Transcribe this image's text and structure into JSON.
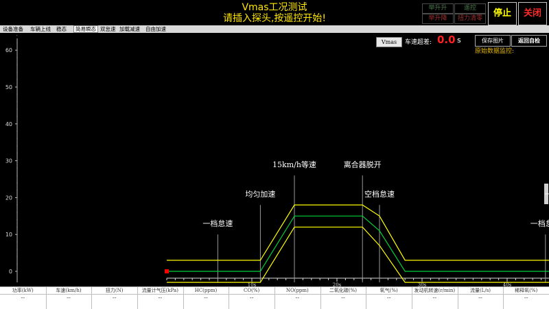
{
  "header": {
    "title": "Vmas工况测试",
    "subtitle": "请插入探头,按遥控开始!",
    "buttons": {
      "lift_up": "举升升",
      "remote": "遥控",
      "lift_down": "举升降",
      "force_clear": "扭力清零",
      "stop": "停止",
      "close": "关闭"
    }
  },
  "tabs": [
    "设备准备",
    "车辆上线",
    "稳态",
    "简易瞬态",
    "双怠速",
    "加载减速",
    "自由加速"
  ],
  "active_tab_index": 3,
  "overlay": {
    "vmas_label": "Vmas",
    "overspeed_label": "车速超差:",
    "overspeed_value": "0.0",
    "overspeed_unit": "s",
    "save_image": "保存图片",
    "return_check": "返回自检",
    "raw_monitor": "原始数据监控:"
  },
  "colors": {
    "title": "#ffe600",
    "limit_line": "#ffff00",
    "target_line": "#00d23c",
    "overspeed": "#ff2020",
    "stop": "#ffff00",
    "close": "#ff2a2a"
  },
  "chart_data": {
    "type": "line",
    "x": [
      0,
      10,
      11,
      15,
      23,
      25,
      28,
      38,
      45
    ],
    "ylim": [
      -3,
      65
    ],
    "yticks": [
      0,
      10,
      20,
      30,
      40,
      50,
      60
    ],
    "xticks": [
      {
        "x": 10,
        "label": "10s"
      },
      {
        "x": 20,
        "label": "20s"
      },
      {
        "x": 30,
        "label": "30s"
      },
      {
        "x": 40,
        "label": "40s"
      }
    ],
    "series": [
      {
        "role": "upper",
        "values": [
          3,
          3,
          3,
          18,
          18,
          15,
          3,
          3,
          3
        ]
      },
      {
        "role": "target",
        "values": [
          0,
          0,
          0,
          15,
          15,
          11,
          0,
          0,
          0
        ]
      },
      {
        "role": "lower",
        "values": [
          -3,
          -3,
          -3,
          12,
          12,
          7,
          -3,
          -3,
          -3
        ]
      }
    ],
    "phase_markers": [
      {
        "x": 6,
        "y_top": 10,
        "label": "一档怠速"
      },
      {
        "x": 11,
        "y_top": 18,
        "label": "均匀加速"
      },
      {
        "x": 15,
        "y_top": 26,
        "label": "15km/h等速"
      },
      {
        "x": 23,
        "y_top": 26,
        "label": "离合器脱开"
      },
      {
        "x": 25,
        "y_top": 18,
        "label": "空档怠速"
      },
      {
        "x": 44.5,
        "y_top": 10,
        "label": "一档怠速"
      },
      {
        "x": 45.3,
        "y_top": 18,
        "label": "一档"
      }
    ],
    "current_point": {
      "x": 0,
      "y": 0
    }
  },
  "table": {
    "headers": [
      "功率(kW)",
      "车速(km/h)",
      "扭力(N)",
      "流量计气压(kPa)",
      "HC(ppm)",
      "CO(%)",
      "NO(ppm)",
      "二氧化碳(%)",
      "氧气(%)",
      "发动机转速(r/min)",
      "流量(L/s)",
      "稀释氧(%)"
    ],
    "values": [
      "--",
      "--",
      "--",
      "--",
      "--",
      "--",
      "--",
      "--",
      "--",
      "--",
      "--",
      "--"
    ]
  }
}
